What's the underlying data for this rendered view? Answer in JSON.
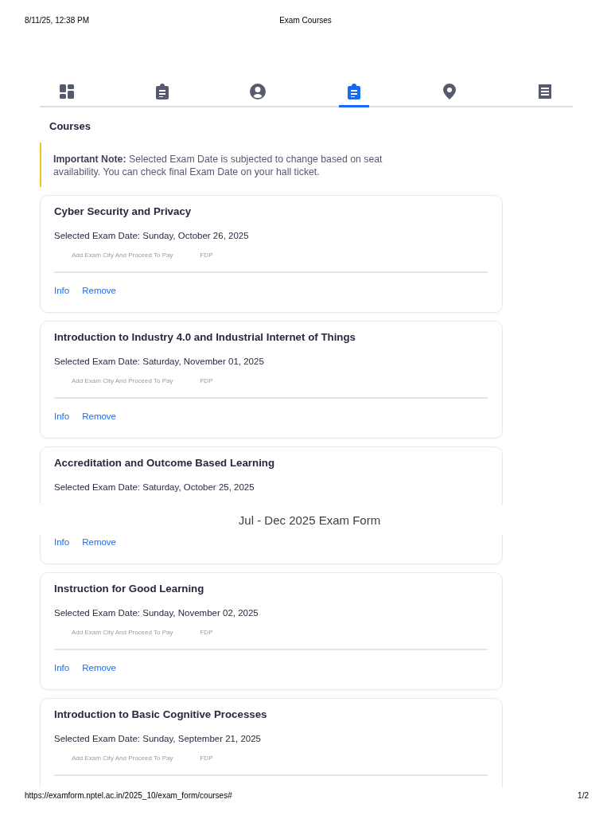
{
  "print_header": {
    "date": "8/11/25, 12:38 PM",
    "title": "Exam Courses"
  },
  "tabs": [
    {
      "kind": "dashboard",
      "selected": false
    },
    {
      "kind": "clipboard",
      "selected": false
    },
    {
      "kind": "account",
      "selected": false
    },
    {
      "kind": "clipboard",
      "selected": true
    },
    {
      "kind": "location",
      "selected": false
    },
    {
      "kind": "receipt",
      "selected": false
    }
  ],
  "heading": "Courses",
  "note": "**Important Note:** Selected Exam Date is subjected to change based on seat availability. You can check final Exam Date on your hall ticket.",
  "courses": [
    {
      "title": "Cyber Security and Privacy",
      "exam_date": "Selected Exam Date: Sunday, October 26, 2025",
      "status": "Add Exam City And Proceed To Pay",
      "category": "FDP",
      "info": "Info",
      "remove": "Remove"
    },
    {
      "title": "Introduction to Industry 4.0 and Industrial Internet of Things",
      "exam_date": "Selected Exam Date: Saturday, November 01, 2025",
      "status": "Add Exam City And Proceed To Pay",
      "category": "FDP",
      "info": "Info",
      "remove": "Remove"
    },
    {
      "title": "Accreditation and Outcome Based Learning",
      "exam_date": "Selected Exam Date: Saturday, October 25, 2025",
      "info": "Info",
      "remove": "Remove"
    },
    {
      "title": "Instruction for Good Learning",
      "exam_date": "Selected Exam Date: Sunday, November 02, 2025",
      "status": "Add Exam City And Proceed To Pay",
      "category": "FDP",
      "info": "Info",
      "remove": "Remove"
    },
    {
      "title": "Introduction to Basic Cognitive Processes",
      "exam_date": "Selected Exam Date: Sunday, September 21, 2025",
      "status": "Add Exam City And Proceed To Pay",
      "category": "FDP"
    }
  ],
  "overlay_title": "Jul - Dec 2025 Exam Form",
  "print_footer": {
    "url": "https://examform.nptel.ac.in/2025_10/exam_form/courses#",
    "page": "1/2"
  }
}
